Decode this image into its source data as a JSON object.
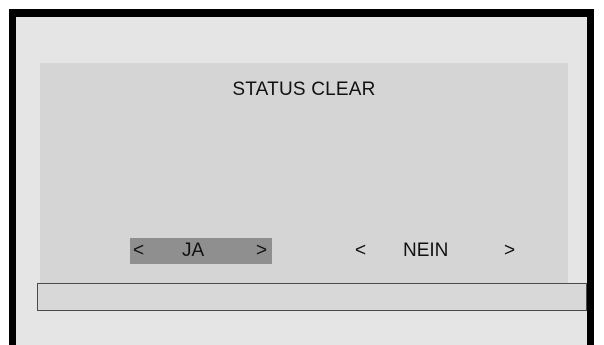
{
  "screen": {
    "title": "STATUS CLEAR"
  },
  "options": {
    "ja": {
      "left_glyph": "<",
      "label": "JA",
      "right_glyph": ">",
      "selected": true
    },
    "nein": {
      "left_glyph": "<",
      "label": "NEIN",
      "right_glyph": ">",
      "selected": false
    }
  },
  "colors": {
    "bezel": "#000000",
    "panel": "#e5e5e5",
    "screen": "#d5d5d5",
    "selection": "#8f8f8f"
  }
}
